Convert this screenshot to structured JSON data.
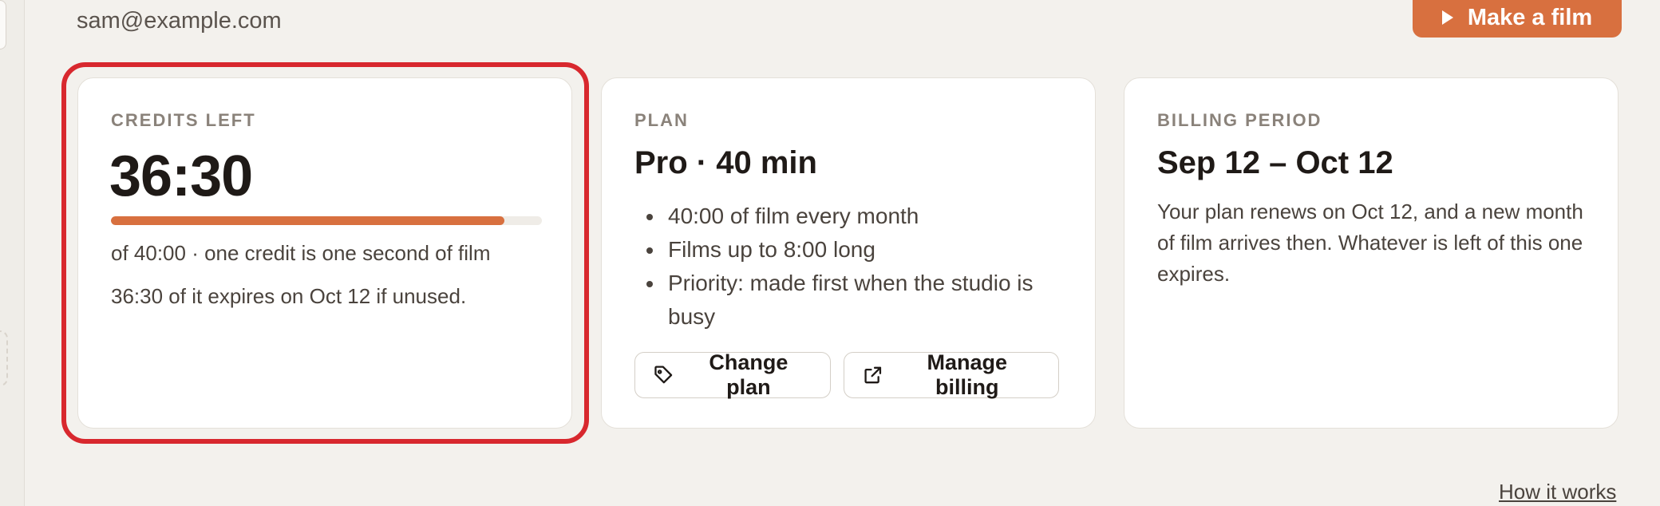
{
  "account": {
    "email": "sam@example.com"
  },
  "header": {
    "make_film_label": "Make a film"
  },
  "credits": {
    "eyebrow": "CREDITS LEFT",
    "remaining": "36:30",
    "progress_fraction": 0.9125,
    "subtitle": "of 40:00 · one credit is one second of film",
    "expiry_note": "36:30 of it expires on Oct 12 if unused."
  },
  "plan": {
    "eyebrow": "PLAN",
    "title": "Pro · 40 min",
    "features": [
      "40:00 of film every month",
      "Films up to 8:00 long",
      "Priority: made first when the studio is busy"
    ],
    "change_plan_label": "Change plan",
    "manage_billing_label": "Manage billing"
  },
  "billing": {
    "eyebrow": "BILLING PERIOD",
    "title": "Sep 12 – Oct 12",
    "description": "Your plan renews on Oct 12, and a new month of film arrives then. Whatever is left of this one expires."
  },
  "footer": {
    "how_it_works_label": "How it works"
  },
  "colors": {
    "accent": "#d8703f",
    "highlight": "#d8282e",
    "background": "#f3f1ed"
  },
  "icons": {
    "make_film": "play-icon",
    "change_plan": "tag-icon",
    "manage_billing": "external-link-icon"
  }
}
